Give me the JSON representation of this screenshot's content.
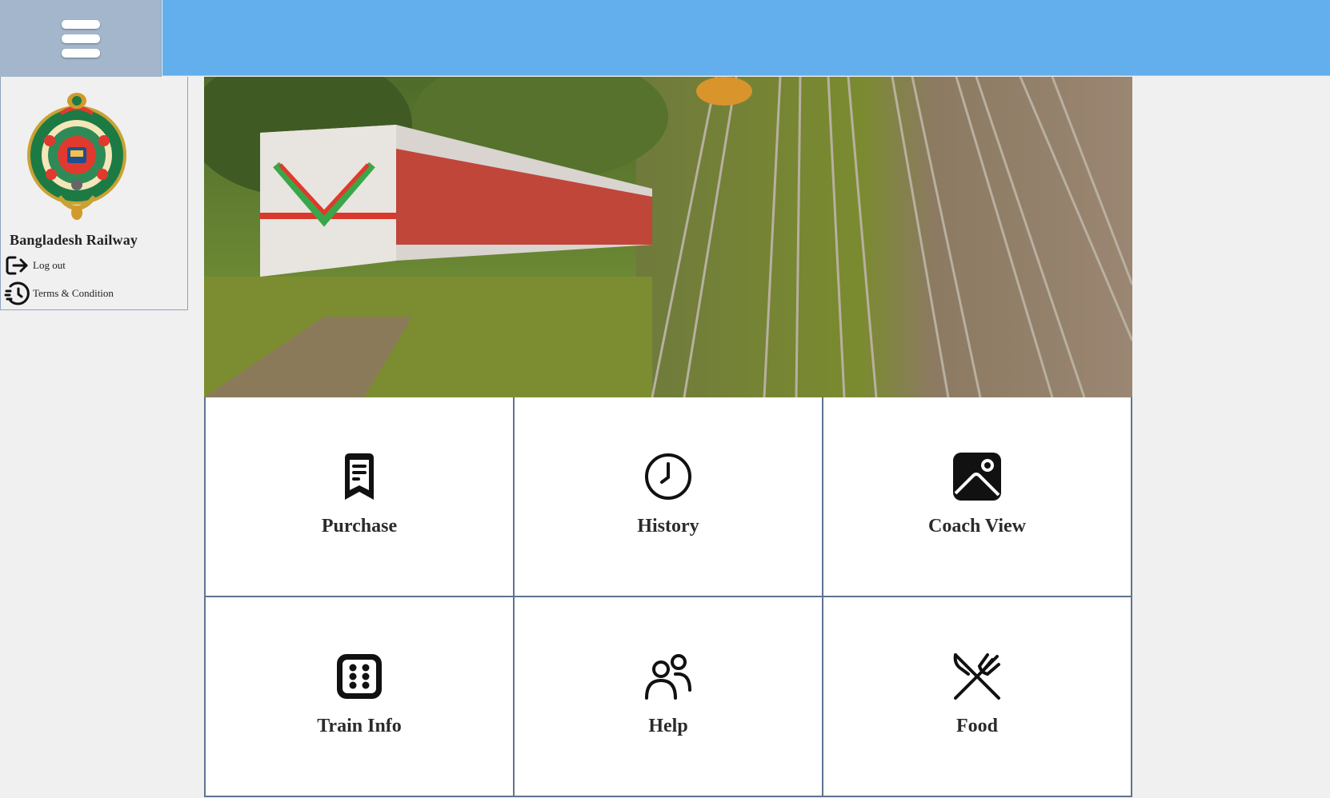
{
  "app": {
    "brand": "Bangladesh Railway"
  },
  "sidebar": {
    "items": [
      {
        "label": "Log out",
        "icon": "logout-icon"
      },
      {
        "label": "Terms & Condition",
        "icon": "history-clock-icon"
      }
    ]
  },
  "tiles": [
    {
      "label": "Purchase",
      "icon": "receipt-icon"
    },
    {
      "label": "History",
      "icon": "clock-icon"
    },
    {
      "label": "Coach View",
      "icon": "image-icon"
    },
    {
      "label": "Train Info",
      "icon": "dice-grid-icon"
    },
    {
      "label": "Help",
      "icon": "users-icon"
    },
    {
      "label": "Food",
      "icon": "fork-knife-icon"
    }
  ],
  "colors": {
    "topbar": "#63aeec",
    "menu_box": "#a3b6cc",
    "background": "#f0f0f0",
    "grid_border": "#5f7391"
  }
}
